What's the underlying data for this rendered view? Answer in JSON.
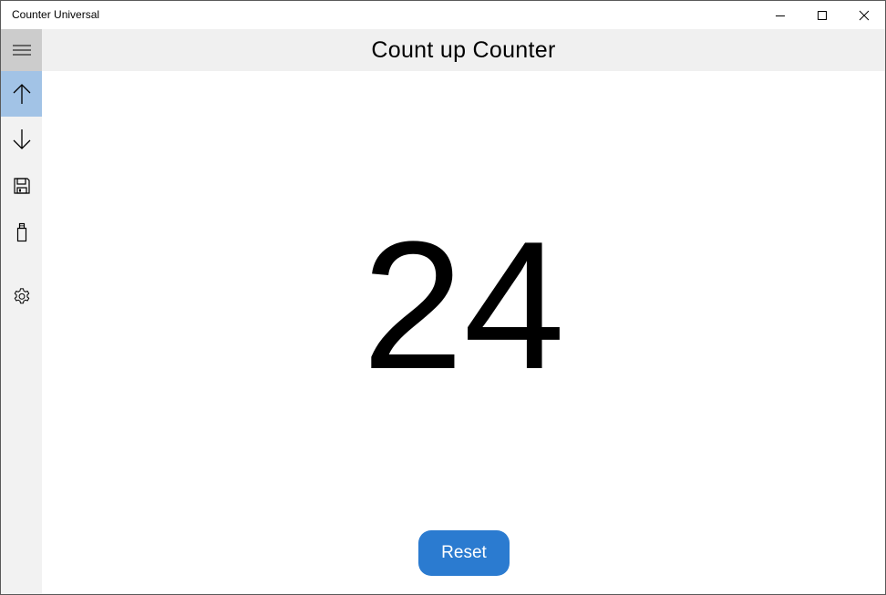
{
  "window": {
    "title": "Counter Universal"
  },
  "titlebar": {
    "minimize_icon": "minimize-icon",
    "maximize_icon": "maximize-icon",
    "close_icon": "close-icon"
  },
  "sidebar": {
    "items": [
      {
        "icon": "hamburger-menu-icon",
        "selected": false
      },
      {
        "icon": "arrow-up-icon",
        "selected": true
      },
      {
        "icon": "arrow-down-icon",
        "selected": false
      },
      {
        "icon": "save-icon",
        "selected": false
      },
      {
        "icon": "usb-drive-icon",
        "selected": false
      },
      {
        "icon": "gear-icon",
        "selected": false
      }
    ]
  },
  "header": {
    "title": "Count up Counter"
  },
  "counter": {
    "value": "24"
  },
  "actions": {
    "reset_label": "Reset"
  },
  "colors": {
    "accent": "#2b7bd0",
    "selected_nav": "#a2c3e6",
    "hamburger_bg": "#cccccc",
    "sidebar_bg": "#f2f2f2",
    "header_bg": "#f0f0f0"
  }
}
